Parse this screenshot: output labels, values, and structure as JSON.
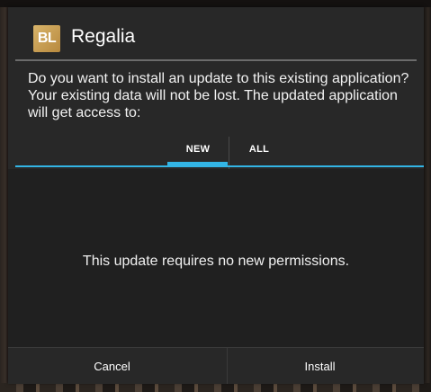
{
  "dialog": {
    "app_icon_text": "BL",
    "app_icon_color": "#c9a257",
    "title": "Regalia",
    "message": "Do you want to install an update to this existing application? Your existing data will not be lost. The updated application will get access to:",
    "tabs": [
      {
        "label": "NEW",
        "selected": true
      },
      {
        "label": "ALL",
        "selected": false
      }
    ],
    "accent_color": "#33b5e5",
    "body_text": "This update requires no new permissions.",
    "buttons": {
      "cancel_label": "Cancel",
      "install_label": "Install"
    }
  }
}
